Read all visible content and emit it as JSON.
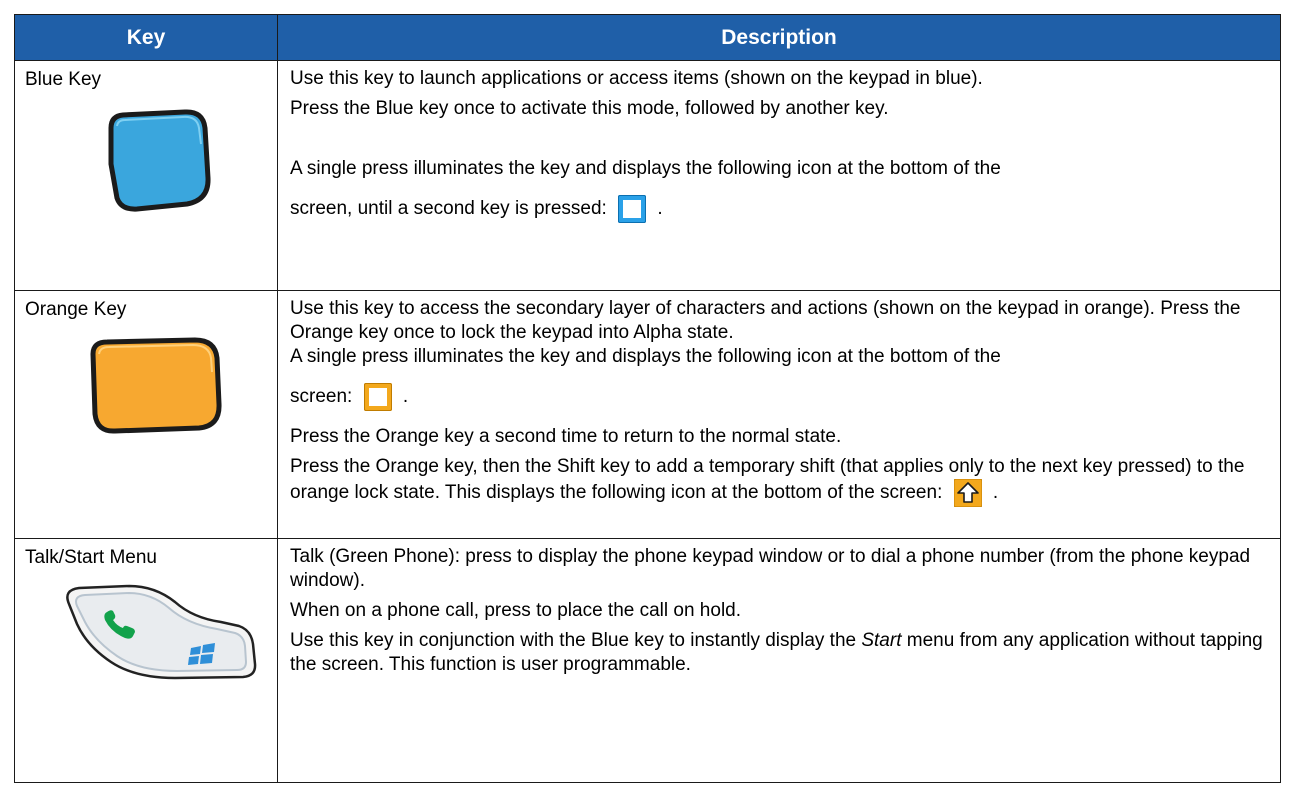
{
  "table": {
    "headers": {
      "key": "Key",
      "description": "Description"
    },
    "rows": [
      {
        "key": "Blue Key",
        "lines": [
          "Use this key to launch applications or access items (shown on the keypad in blue).",
          "Press the Blue key once to activate this mode, followed by another key.",
          "A single press illuminates the key and displays the following icon at the bottom of the",
          "screen, until a second key is pressed:",
          "."
        ]
      },
      {
        "key": "Orange Key",
        "lines": [
          "Use this key to access the secondary layer of characters and actions (shown on the keypad in orange). Press the Orange key once to lock the keypad into Alpha state.",
          "A single press illuminates the key and displays the following icon at the bottom of the",
          "screen:",
          ".",
          "Press the Orange key a second time to return to the normal state.",
          "Press the Orange key, then the Shift key to add a temporary shift (that applies only to the next key pressed) to the orange lock state. This displays the following icon at the bottom of the screen:",
          "."
        ]
      },
      {
        "key": "Talk/Start Menu",
        "lines": [
          "Talk (Green Phone): press to display the phone keypad window or to dial a phone number (from the phone keypad window).",
          "When on a phone call, press to place the call on hold.",
          "Use this key in conjunction with the Blue key to instantly display the ",
          "Start",
          " menu from any application without tapping the screen. This function is user programmable."
        ]
      }
    ]
  },
  "icons": {
    "blue_key": "blue-key-icon",
    "blue_mode": "blue-mode-indicator-icon",
    "orange_key": "orange-key-icon",
    "orange_mode": "orange-mode-indicator-icon",
    "shift_mode": "orange-shift-indicator-icon",
    "talk_start": "talk-start-key-icon"
  },
  "colors": {
    "header_bg": "#1f5fa8",
    "blue_key": "#3aa6dd",
    "orange_key": "#f7a830",
    "talk_green": "#12a24b",
    "start_blue": "#2f8fd8"
  }
}
